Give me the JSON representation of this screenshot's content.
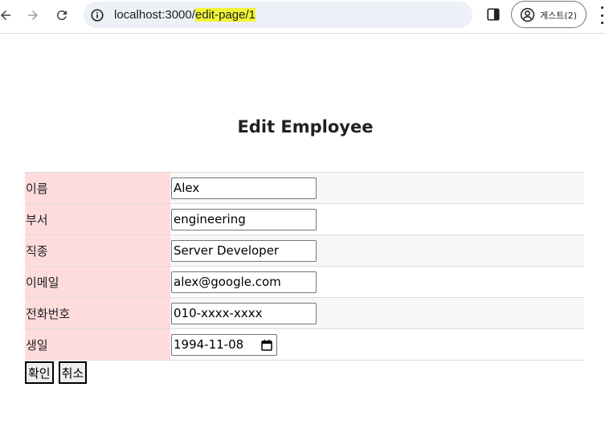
{
  "browser": {
    "url_host": "localhost:3000/",
    "url_path": "edit-page/1",
    "profile_label": "게스트(2)"
  },
  "page": {
    "title": "Edit Employee"
  },
  "form": {
    "rows": [
      {
        "label": "이름",
        "value": "Alex"
      },
      {
        "label": "부서",
        "value": "engineering"
      },
      {
        "label": "직종",
        "value": "Server Developer"
      },
      {
        "label": "이메일",
        "value": "alex@google.com"
      },
      {
        "label": "전화번호",
        "value": "010-xxxx-xxxx"
      },
      {
        "label": "생일",
        "value": "1994-11-08"
      }
    ],
    "confirm_label": "확인",
    "cancel_label": "취소"
  },
  "colors": {
    "label_bg": "#ffdcdc",
    "row_alt_bg": "#f7f7f7",
    "omnibox_bg": "#edf0f7",
    "url_highlight": "#f1f533"
  }
}
